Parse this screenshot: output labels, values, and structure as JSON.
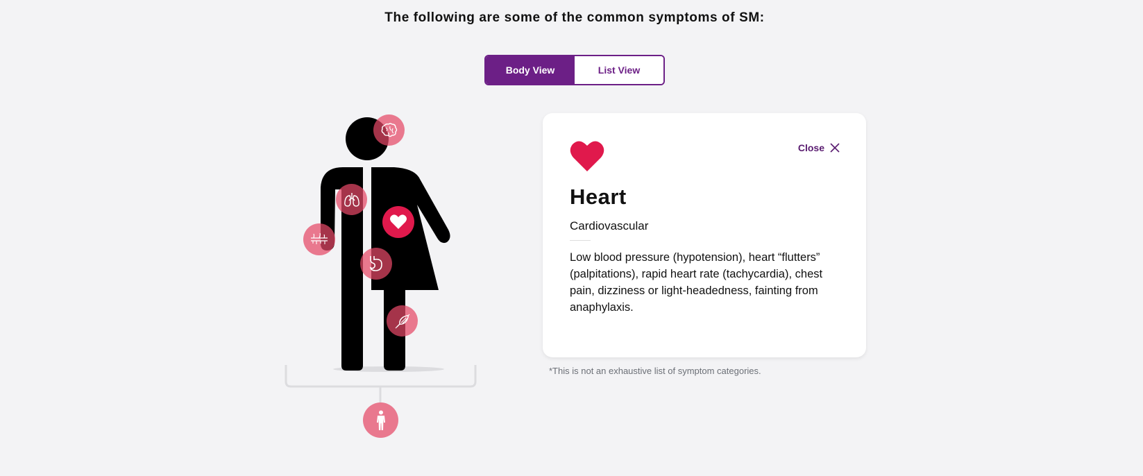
{
  "heading": "The following are some of the common symptoms of SM:",
  "toggle": {
    "body_view_label": "Body View",
    "list_view_label": "List View",
    "active": "body_view"
  },
  "body_map": {
    "hotspots": [
      {
        "name": "brain",
        "icon": "brain-icon",
        "state": "inactive"
      },
      {
        "name": "lungs",
        "icon": "lungs-icon",
        "state": "inactive"
      },
      {
        "name": "heart",
        "icon": "heart-icon",
        "state": "active"
      },
      {
        "name": "skin",
        "icon": "skin-icon",
        "state": "inactive"
      },
      {
        "name": "stomach",
        "icon": "stomach-icon",
        "state": "inactive"
      },
      {
        "name": "muscle",
        "icon": "muscle-icon",
        "state": "inactive"
      },
      {
        "name": "full-body",
        "icon": "person-icon",
        "state": "inactive"
      }
    ]
  },
  "card": {
    "icon": "heart-icon",
    "close_label": "Close",
    "title": "Heart",
    "subtitle": "Cardiovascular",
    "body": "Low blood pressure (hypotension), heart “flutters” (palpitations), rapid heart rate (tachycardia), chest pain, dizziness or light-headedness, fainting from anaphylaxis."
  },
  "disclaimer": "*This is not an exhaustive list of symptom categories.",
  "colors": {
    "background": "#f3f3f5",
    "accent_purple": "#6c1f86",
    "heart_red": "#e0194c",
    "hotspot_pink": "#e54867"
  }
}
